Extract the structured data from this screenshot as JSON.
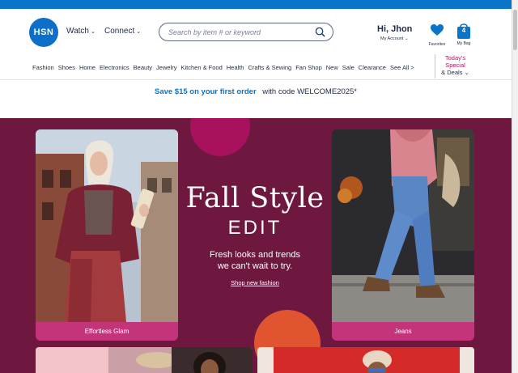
{
  "header": {
    "logo_text": "HSN",
    "nav": {
      "watch": "Watch",
      "connect": "Connect"
    },
    "search": {
      "placeholder": "Search by item # or keyword"
    },
    "account": {
      "greeting": "Hi, Jhon",
      "my_account": "My Account"
    },
    "favorites_label": "Favorites",
    "bag": {
      "label": "My Bag",
      "count": "4"
    }
  },
  "categories": [
    "Fashion",
    "Shoes",
    "Home",
    "Electronics",
    "Beauty",
    "Jewelry",
    "Kitchen & Food",
    "Health",
    "Crafts & Sewing",
    "Fan Shop",
    "New",
    "Sale",
    "Clearance",
    "See All >"
  ],
  "deals": {
    "line1": "Today's",
    "line2": "Special",
    "line3": "& Deals"
  },
  "promo": {
    "link_text": "Save $15 on your first order",
    "code_text": "with code WELCOME2025*"
  },
  "hero": {
    "title_line1": "Fall Style",
    "title_line2": "EDIT",
    "desc_line1": "Fresh looks and trends",
    "desc_line2": "we can't wait to try.",
    "shop_link": "Shop new fashion",
    "left_card_label": "Effortless Glam",
    "right_card_label": "Jeans"
  },
  "colors": {
    "brand_blue": "#0a74c9",
    "hero_bg": "#6e1840",
    "card_label_bg": "#c3347b",
    "accent_pink": "#a8115e",
    "accent_orange": "#e0552f"
  }
}
